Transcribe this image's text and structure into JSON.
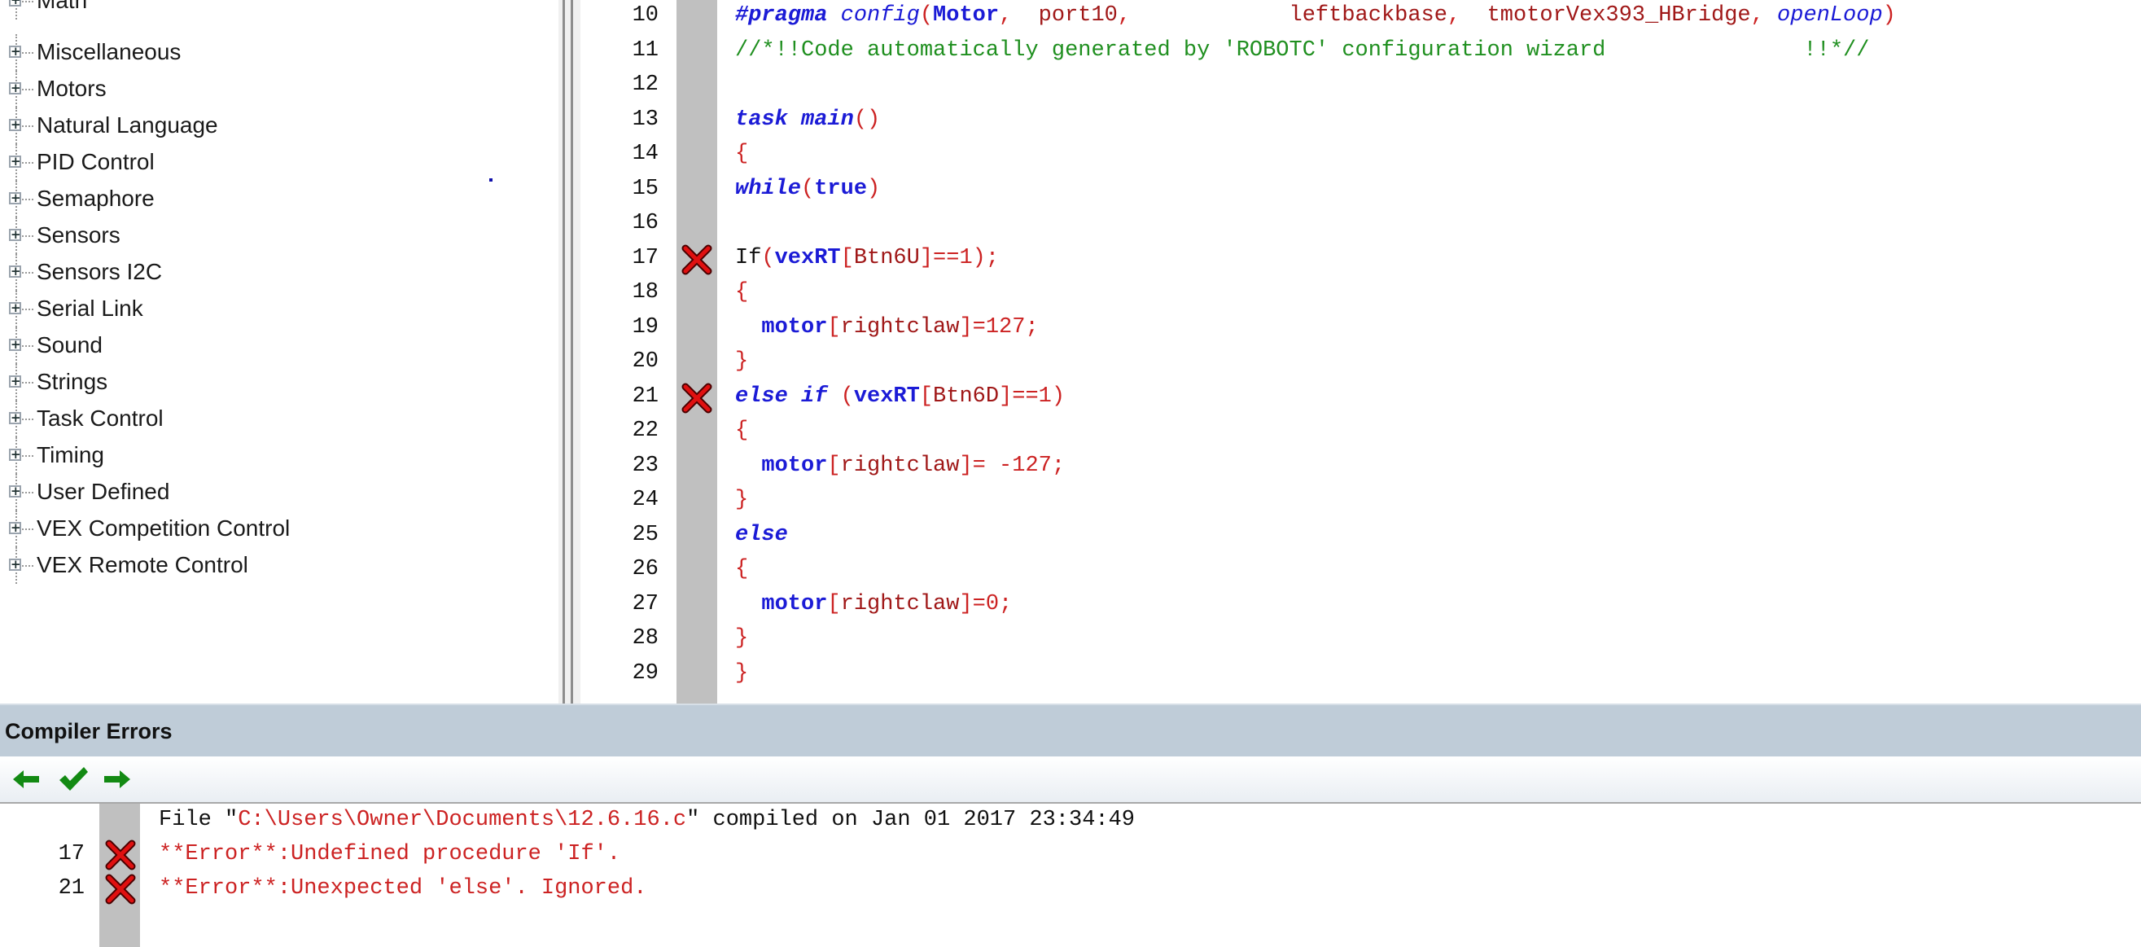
{
  "function_tree": {
    "items": [
      {
        "label": "Math"
      },
      {
        "label": "Miscellaneous"
      },
      {
        "label": "Motors"
      },
      {
        "label": "Natural Language"
      },
      {
        "label": "PID Control"
      },
      {
        "label": "Semaphore"
      },
      {
        "label": "Sensors"
      },
      {
        "label": "Sensors I2C"
      },
      {
        "label": "Serial Link"
      },
      {
        "label": "Sound"
      },
      {
        "label": "Strings"
      },
      {
        "label": "Task Control"
      },
      {
        "label": "Timing"
      },
      {
        "label": "User Defined"
      },
      {
        "label": "VEX Competition Control"
      },
      {
        "label": "VEX Remote Control"
      }
    ]
  },
  "editor": {
    "lines": [
      {
        "num": "10",
        "error": false,
        "tokens": [
          {
            "t": "#pragma ",
            "c": "kw"
          },
          {
            "t": "config",
            "c": "kwi"
          },
          {
            "t": "(",
            "c": "red"
          },
          {
            "t": "Motor",
            "c": "id"
          },
          {
            "t": ",  ",
            "c": "red"
          },
          {
            "t": "port10",
            "c": "brown"
          },
          {
            "t": ",            ",
            "c": "red"
          },
          {
            "t": "leftbackbase",
            "c": "brown"
          },
          {
            "t": ",  ",
            "c": "red"
          },
          {
            "t": "tmotorVex393_HBridge",
            "c": "brown"
          },
          {
            "t": ", ",
            "c": "red"
          },
          {
            "t": "openLoop",
            "c": "kwi"
          },
          {
            "t": ")",
            "c": "red"
          }
        ]
      },
      {
        "num": "11",
        "error": false,
        "tokens": [
          {
            "t": "//*!!Code automatically generated by 'ROBOTC' configuration wizard               !!*//",
            "c": "green"
          }
        ]
      },
      {
        "num": "12",
        "error": false,
        "tokens": []
      },
      {
        "num": "13",
        "error": false,
        "tokens": [
          {
            "t": "task ",
            "c": "kw"
          },
          {
            "t": "main",
            "c": "kw"
          },
          {
            "t": "()",
            "c": "red"
          }
        ]
      },
      {
        "num": "14",
        "error": false,
        "tokens": [
          {
            "t": "{",
            "c": "red"
          }
        ]
      },
      {
        "num": "15",
        "error": false,
        "tokens": [
          {
            "t": "while",
            "c": "kw"
          },
          {
            "t": "(",
            "c": "red"
          },
          {
            "t": "true",
            "c": "id"
          },
          {
            "t": ")",
            "c": "red"
          }
        ]
      },
      {
        "num": "16",
        "error": false,
        "tokens": []
      },
      {
        "num": "17",
        "error": true,
        "tokens": [
          {
            "t": "If",
            "c": "plain"
          },
          {
            "t": "(",
            "c": "red"
          },
          {
            "t": "vexRT",
            "c": "id"
          },
          {
            "t": "[",
            "c": "red"
          },
          {
            "t": "Btn6U",
            "c": "brown"
          },
          {
            "t": "]==1);",
            "c": "red"
          }
        ]
      },
      {
        "num": "18",
        "error": false,
        "tokens": [
          {
            "t": "{",
            "c": "red"
          }
        ]
      },
      {
        "num": "19",
        "error": false,
        "tokens": [
          {
            "t": "  ",
            "c": "plain"
          },
          {
            "t": "motor",
            "c": "id"
          },
          {
            "t": "[",
            "c": "red"
          },
          {
            "t": "rightclaw",
            "c": "brown"
          },
          {
            "t": "]=127;",
            "c": "red"
          }
        ]
      },
      {
        "num": "20",
        "error": false,
        "tokens": [
          {
            "t": "}",
            "c": "red"
          }
        ]
      },
      {
        "num": "21",
        "error": true,
        "tokens": [
          {
            "t": "else if ",
            "c": "kw"
          },
          {
            "t": "(",
            "c": "red"
          },
          {
            "t": "vexRT",
            "c": "id"
          },
          {
            "t": "[",
            "c": "red"
          },
          {
            "t": "Btn6D",
            "c": "brown"
          },
          {
            "t": "]==1)",
            "c": "red"
          }
        ]
      },
      {
        "num": "22",
        "error": false,
        "tokens": [
          {
            "t": "{",
            "c": "red"
          }
        ]
      },
      {
        "num": "23",
        "error": false,
        "tokens": [
          {
            "t": "  ",
            "c": "plain"
          },
          {
            "t": "motor",
            "c": "id"
          },
          {
            "t": "[",
            "c": "red"
          },
          {
            "t": "rightclaw",
            "c": "brown"
          },
          {
            "t": "]= -127;",
            "c": "red"
          }
        ]
      },
      {
        "num": "24",
        "error": false,
        "tokens": [
          {
            "t": "}",
            "c": "red"
          }
        ]
      },
      {
        "num": "25",
        "error": false,
        "tokens": [
          {
            "t": "else",
            "c": "kw"
          }
        ]
      },
      {
        "num": "26",
        "error": false,
        "tokens": [
          {
            "t": "{",
            "c": "red"
          }
        ]
      },
      {
        "num": "27",
        "error": false,
        "tokens": [
          {
            "t": "  ",
            "c": "plain"
          },
          {
            "t": "motor",
            "c": "id"
          },
          {
            "t": "[",
            "c": "red"
          },
          {
            "t": "rightclaw",
            "c": "brown"
          },
          {
            "t": "]=0;",
            "c": "red"
          }
        ]
      },
      {
        "num": "28",
        "error": false,
        "tokens": [
          {
            "t": "}",
            "c": "red"
          }
        ]
      },
      {
        "num": "29",
        "error": false,
        "tokens": [
          {
            "t": "}",
            "c": "red"
          }
        ]
      }
    ]
  },
  "compiler_panel": {
    "title": "Compiler Errors",
    "toolbar": {
      "prev_icon": "arrow-left-icon",
      "check_icon": "checkmark-icon",
      "next_icon": "arrow-right-icon"
    },
    "messages": [
      {
        "line": "",
        "error": false,
        "tokens": [
          {
            "t": "File \"",
            "c": "plain"
          },
          {
            "t": "C:\\Users\\Owner\\Documents\\12.6.16.c",
            "c": "red"
          },
          {
            "t": "\" compiled on Jan 01 2017 23:34:49",
            "c": "plain"
          }
        ]
      },
      {
        "line": "17",
        "error": true,
        "tokens": [
          {
            "t": "**Error**:Undefined procedure 'If'.",
            "c": "red"
          }
        ]
      },
      {
        "line": "21",
        "error": true,
        "tokens": [
          {
            "t": "**Error**:Unexpected 'else'. Ignored.",
            "c": "red"
          }
        ]
      }
    ]
  },
  "colors": {
    "keyword": "#1b1bd6",
    "operator": "#cc2222",
    "identifier_value": "#a01818",
    "comment": "#1f8f1f",
    "error_marker": "#e01010",
    "toolbar_green": "#138a13",
    "panel_header": "#bfccd8"
  }
}
